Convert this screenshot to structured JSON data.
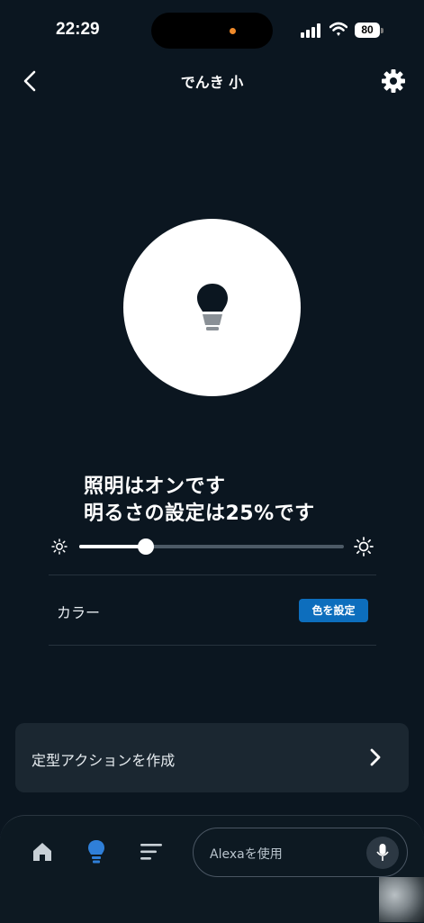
{
  "status_bar": {
    "time": "22:29",
    "battery": "80"
  },
  "header": {
    "title": "でんき 小"
  },
  "device": {
    "power_status": "照明はオンです",
    "brightness_status": "明るさの設定は25%です",
    "brightness_percent": 25
  },
  "color": {
    "label": "カラー",
    "button": "色を設定"
  },
  "routine": {
    "label": "定型アクションを作成"
  },
  "bottom_nav": {
    "alexa_placeholder": "Alexaを使用"
  },
  "colors": {
    "background": "#0b1620",
    "accent": "#0d6ebd",
    "card": "#1b2731",
    "active_nav": "#2f7fd8"
  }
}
